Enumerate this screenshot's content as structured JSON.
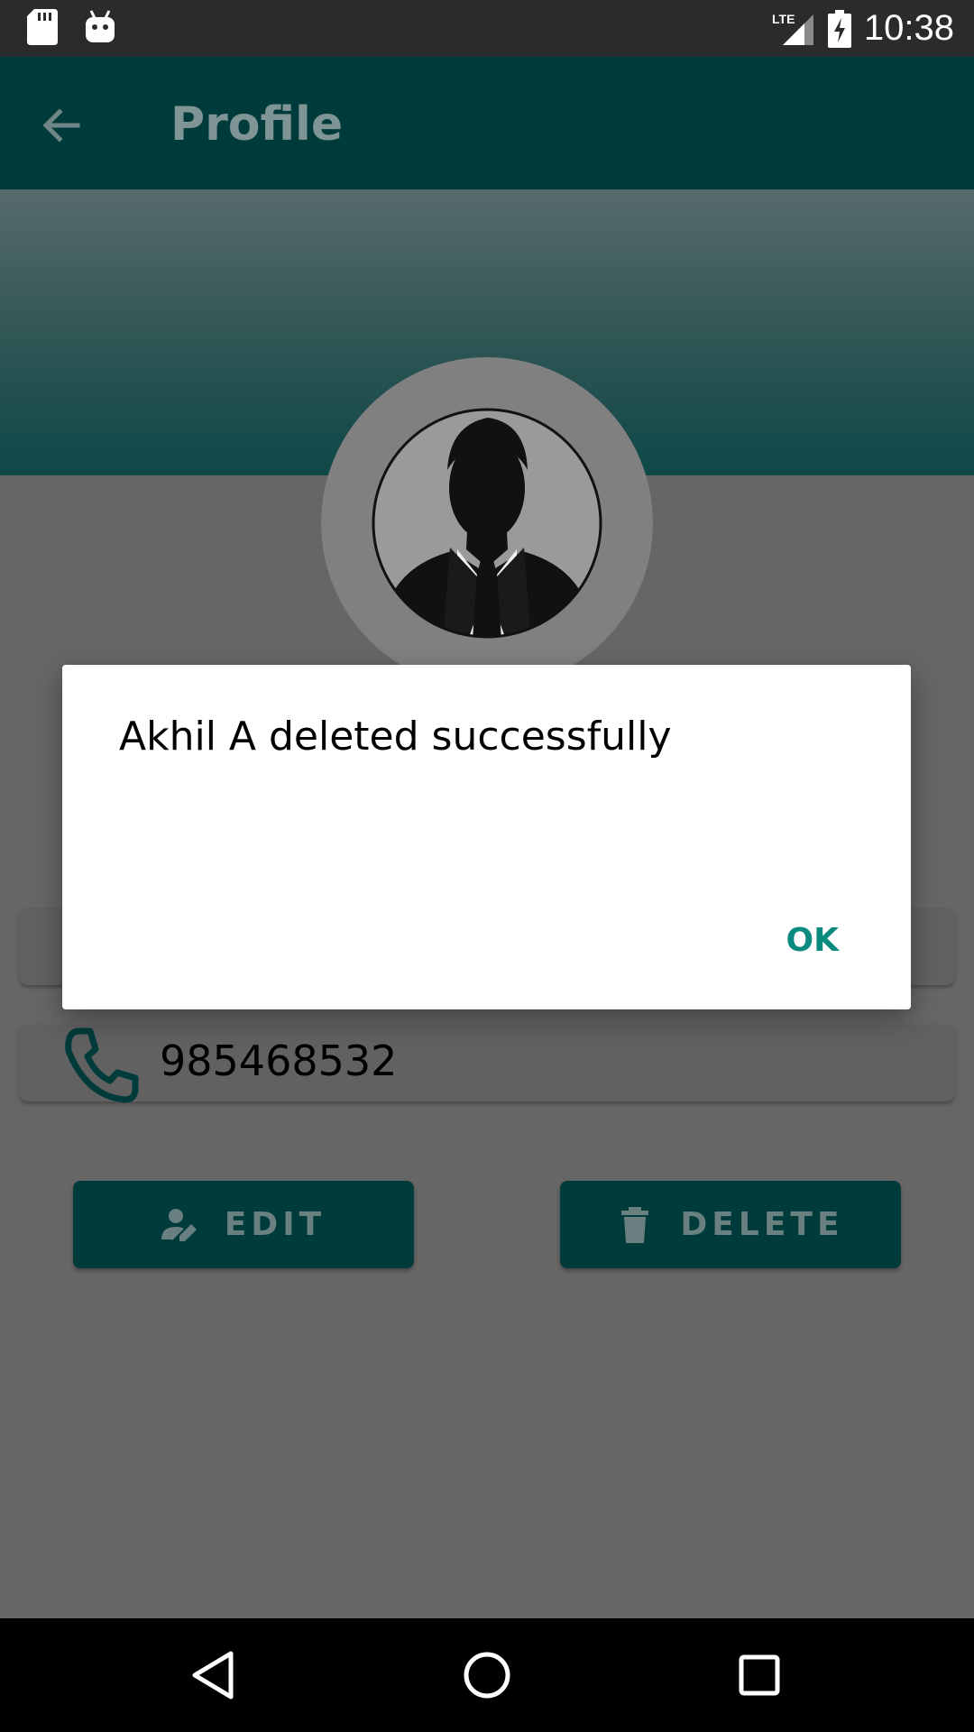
{
  "status_bar": {
    "time": "10:38",
    "network": "LTE",
    "icons": [
      "sd-card-icon",
      "android-icon",
      "signal-icon",
      "battery-charging-icon"
    ]
  },
  "app_bar": {
    "title": "Profile",
    "back_icon": "back-arrow-icon"
  },
  "profile": {
    "avatar_icon": "person-silhouette-icon",
    "phone": "985468532",
    "phone_icon": "phone-icon"
  },
  "actions": {
    "edit_label": "EDIT",
    "edit_icon": "person-edit-icon",
    "delete_label": "DELETE",
    "delete_icon": "trash-icon"
  },
  "dialog": {
    "message": "Akhil A deleted successfully",
    "ok_label": "OK"
  },
  "navigation": {
    "icons": [
      "nav-back-icon",
      "nav-home-icon",
      "nav-recents-icon"
    ]
  },
  "colors": {
    "primary_dark": "#003b3b",
    "accent": "#0b8a80",
    "scrim": "#666666"
  }
}
